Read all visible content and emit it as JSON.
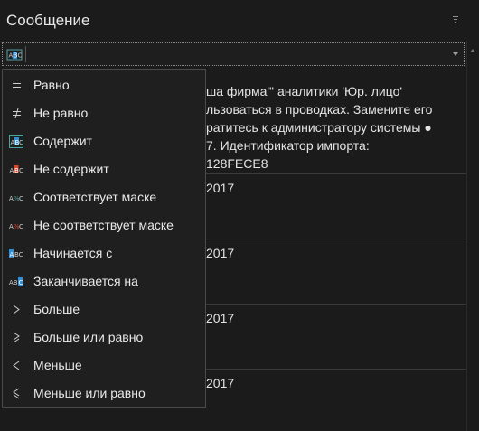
{
  "header": {
    "title": "Сообщение"
  },
  "content": {
    "message_lines": [
      "ша фирма\"' аналитики 'Юр. лицо'",
      "льзоваться в проводках. Замените его",
      "ратитесь к администратору системы ●",
      "7. Идентификатор импорта:",
      "128FECE8"
    ],
    "dates": [
      "2017",
      "2017",
      "2017",
      "2017"
    ]
  },
  "menu": {
    "items": [
      {
        "label": "Равно",
        "icon": "equals-icon"
      },
      {
        "label": "Не равно",
        "icon": "not-equals-icon"
      },
      {
        "label": "Содержит",
        "icon": "contains-icon"
      },
      {
        "label": "Не содержит",
        "icon": "not-contains-icon"
      },
      {
        "label": "Соответствует маске",
        "icon": "like-icon"
      },
      {
        "label": "Не соответствует маске",
        "icon": "not-like-icon"
      },
      {
        "label": "Начинается с",
        "icon": "begins-with-icon"
      },
      {
        "label": "Заканчивается на",
        "icon": "ends-with-icon"
      },
      {
        "label": "Больше",
        "icon": "greater-icon"
      },
      {
        "label": "Больше или равно",
        "icon": "greater-or-equal-icon"
      },
      {
        "label": "Меньше",
        "icon": "less-icon"
      },
      {
        "label": "Меньше или равно",
        "icon": "less-or-equal-icon"
      }
    ],
    "selected_index": 2
  },
  "colors": {
    "background": "#1b1b1c",
    "menu_bg": "#1f1f1f",
    "accent_blue": "#2f8fd8",
    "accent_red": "#d9472b",
    "accent_teal": "#4fa3a0",
    "text": "#e6e6e6"
  }
}
